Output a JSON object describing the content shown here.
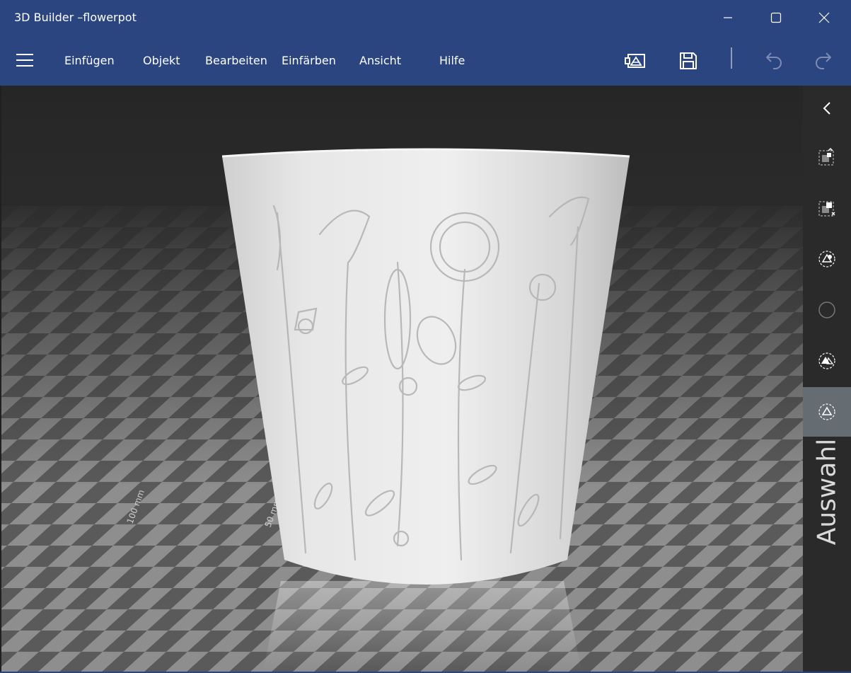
{
  "window": {
    "title": "3D Builder –flowerpot",
    "controls": {
      "minimize": "minimize-icon",
      "maximize": "maximize-icon",
      "close": "close-icon"
    }
  },
  "toolbar": {
    "menu_icon": "hamburger-menu-icon",
    "menu_items": [
      "Einfügen",
      "Objekt",
      "Bearbeiten",
      "Einfärben",
      "Ansicht",
      "Hilfe"
    ],
    "actions": [
      "print-3d-icon",
      "save-icon",
      "undo-icon",
      "redo-icon"
    ]
  },
  "viewport": {
    "scale_labels": [
      "100 mm",
      "50 mm"
    ],
    "model": "flowerpot"
  },
  "side_panel": {
    "collapse_icon": "chevron-left-icon",
    "tools": [
      "select-objects-icon",
      "select-faces-icon",
      "select-vertices-icon",
      "select-edges-icon",
      "select-triangles-icon",
      "select-mesh-icon"
    ],
    "active_tool_index": 5,
    "label": "Auswahl"
  },
  "colors": {
    "titlebar": "#2b4580",
    "panel": "#2a2a2a",
    "active": "#656c72"
  }
}
